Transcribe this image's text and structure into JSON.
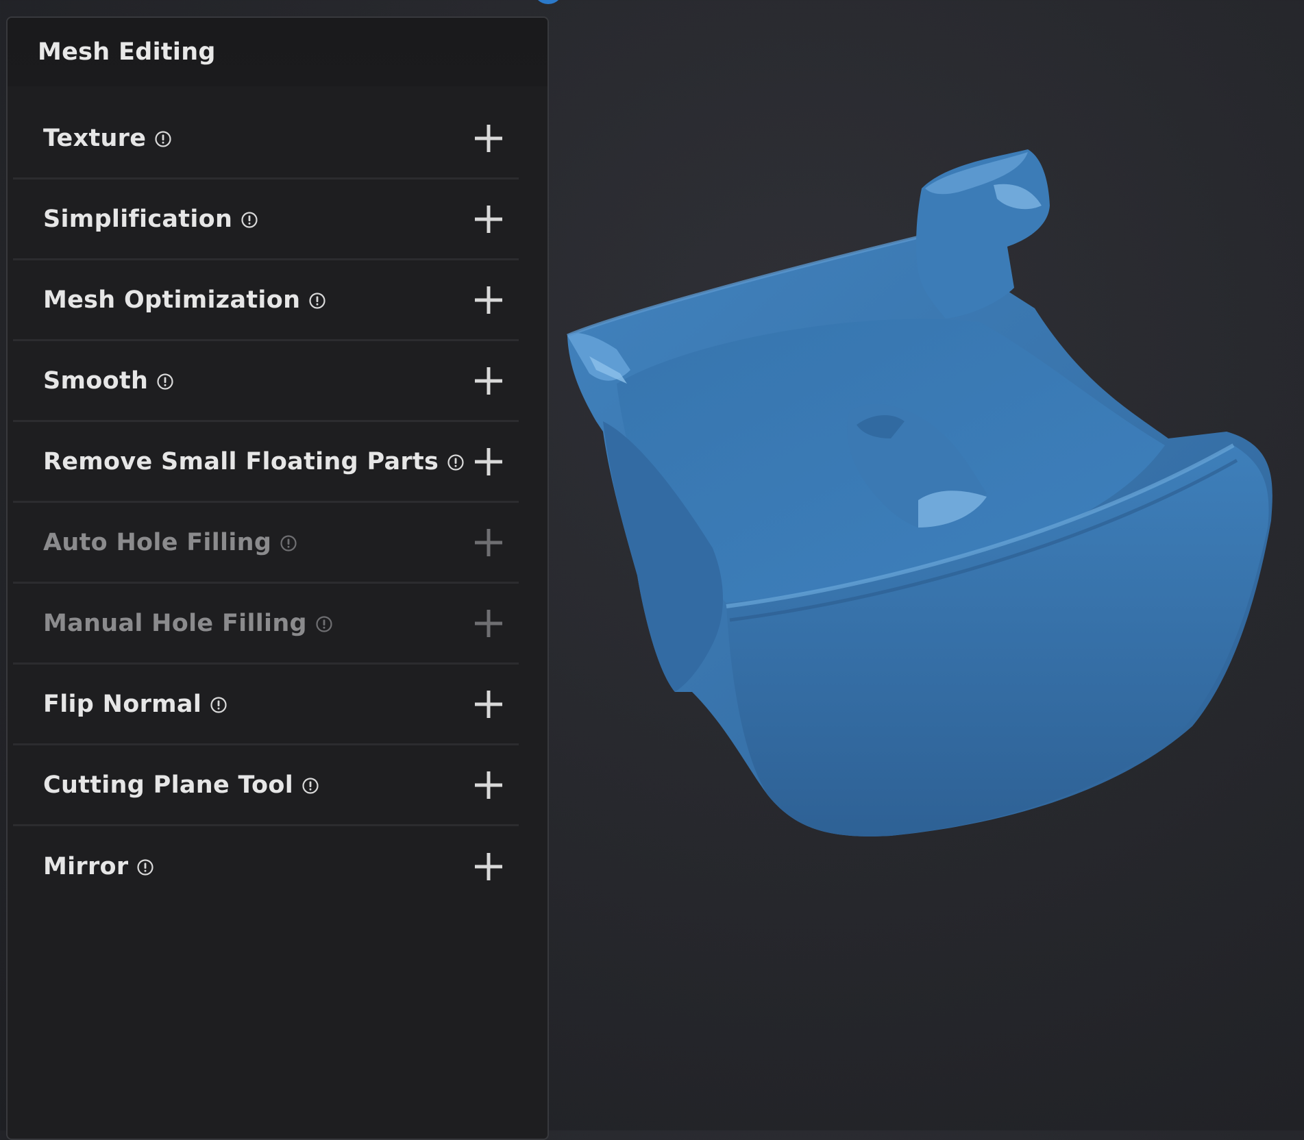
{
  "panel": {
    "title": "Mesh Editing",
    "tools": [
      {
        "label": "Texture",
        "enabled": true
      },
      {
        "label": "Simplification",
        "enabled": true
      },
      {
        "label": "Mesh Optimization",
        "enabled": true
      },
      {
        "label": "Smooth",
        "enabled": true
      },
      {
        "label": "Remove Small Floating Parts",
        "enabled": true
      },
      {
        "label": "Auto Hole Filling",
        "enabled": false
      },
      {
        "label": "Manual Hole Filling",
        "enabled": false
      },
      {
        "label": "Flip Normal",
        "enabled": true
      },
      {
        "label": "Cutting Plane Tool",
        "enabled": true
      },
      {
        "label": "Mirror",
        "enabled": true
      }
    ]
  },
  "icons": {
    "info": "info-circle-icon",
    "expand": "plus-icon"
  },
  "colors": {
    "mesh": "#3a77b0",
    "panel_bg": "#1e1e20",
    "text": "#e6e6e6",
    "text_disabled": "#8b8b8d",
    "icon": "#d9d9d9",
    "icon_disabled": "#6f6f72"
  }
}
